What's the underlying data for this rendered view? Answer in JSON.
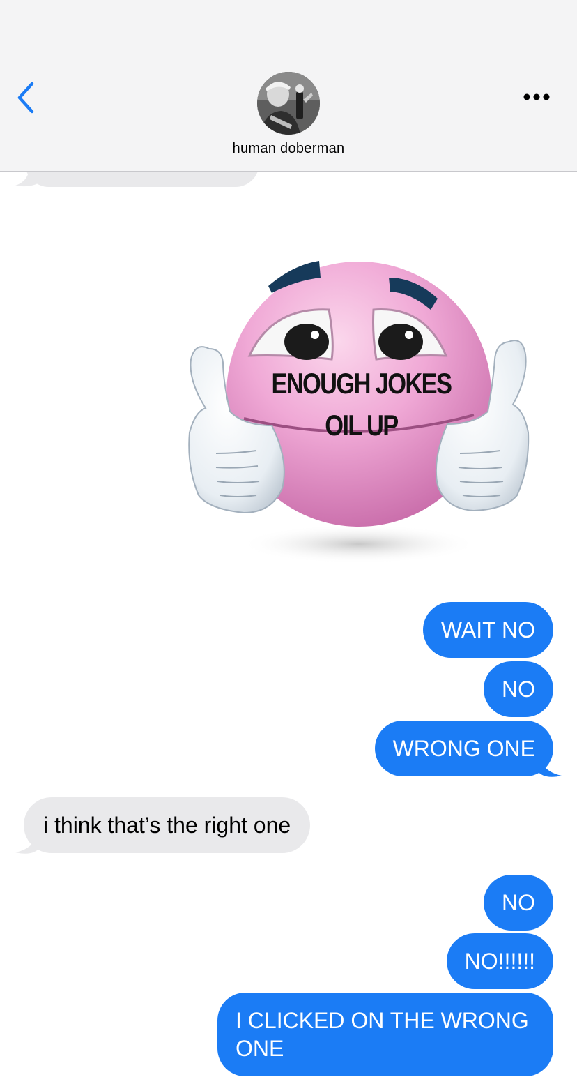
{
  "header": {
    "back_icon": "chevron-left-icon",
    "more_icon": "ellipsis-icon",
    "contact_name": "human doberman",
    "accent_color": "#1b7cf5"
  },
  "sticker": {
    "line1": "ENOUGH JOKES",
    "line2": "OIL UP"
  },
  "messages": [
    {
      "direction": "outgoing",
      "text": "WAIT NO"
    },
    {
      "direction": "outgoing",
      "text": "NO"
    },
    {
      "direction": "outgoing",
      "text": "WRONG ONE"
    },
    {
      "direction": "incoming",
      "text": "i think that’s the right one"
    },
    {
      "direction": "outgoing",
      "text": "NO"
    },
    {
      "direction": "outgoing",
      "text": "NO!!!!!!"
    },
    {
      "direction": "outgoing",
      "text": "I CLICKED ON THE WRONG ONE"
    }
  ],
  "colors": {
    "outgoing_bubble": "#1b7cf5",
    "incoming_bubble": "#e9e9eb",
    "header_bg": "#f4f4f5"
  }
}
